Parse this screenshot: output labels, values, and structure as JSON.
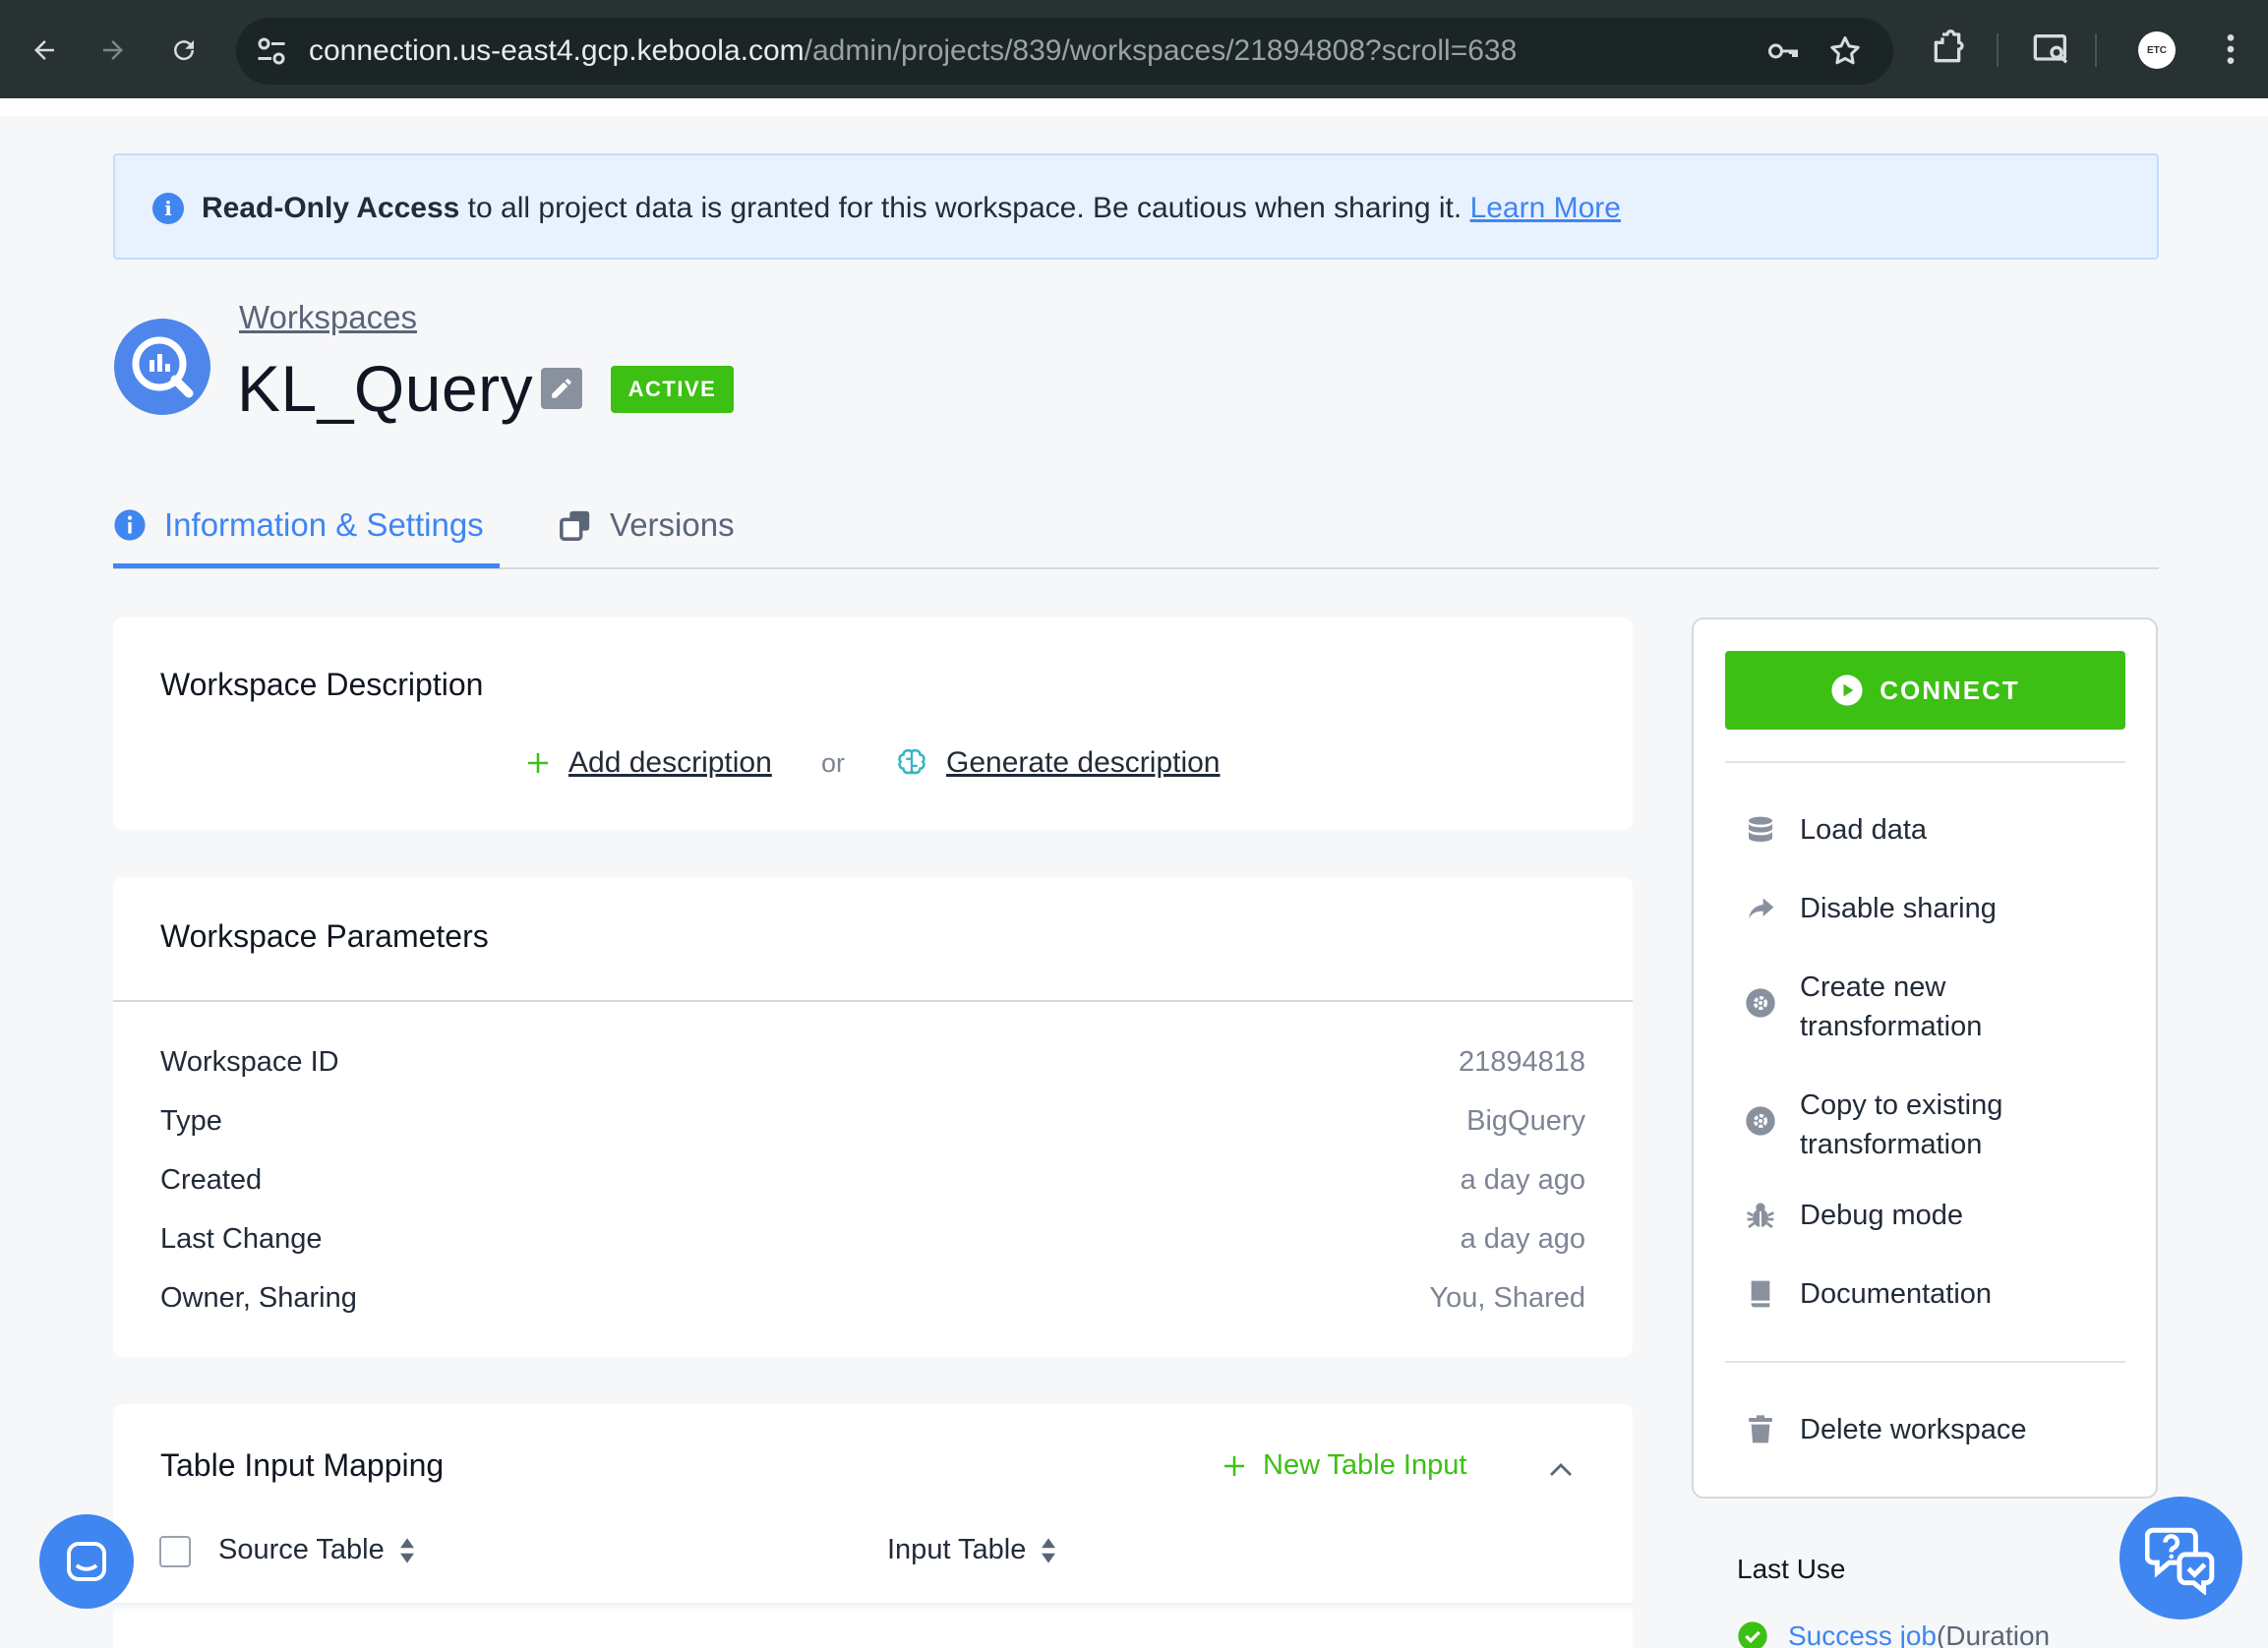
{
  "browser": {
    "url_host": "connection.us-east4.gcp.keboola.com",
    "url_path": "/admin/projects/839/workspaces/21894808?scroll=638",
    "profile_initials": "ETC"
  },
  "alert": {
    "bold": "Read-Only Access",
    "text": " to all project data is granted for this workspace. Be cautious when sharing it. ",
    "link": "Learn More"
  },
  "header": {
    "breadcrumb": "Workspaces",
    "title": "KL_Query",
    "status": "ACTIVE"
  },
  "tabs": [
    {
      "label": "Information & Settings",
      "active": true
    },
    {
      "label": "Versions",
      "active": false
    }
  ],
  "description_card": {
    "title": "Workspace Description",
    "add_label": "Add description",
    "or_label": "or",
    "generate_label": "Generate description"
  },
  "parameters_card": {
    "title": "Workspace Parameters",
    "rows": [
      {
        "key": "Workspace ID",
        "value": "21894818"
      },
      {
        "key": "Type",
        "value": "BigQuery"
      },
      {
        "key": "Created",
        "value": "a day ago"
      },
      {
        "key": "Last Change",
        "value": "a day ago"
      },
      {
        "key": "Owner, Sharing",
        "value": "You, Shared"
      }
    ]
  },
  "mapping_card": {
    "title": "Table Input Mapping",
    "new_input_label": "New Table Input",
    "columns": [
      "Source Table",
      "Input Table"
    ]
  },
  "sidebar": {
    "connect_label": "CONNECT",
    "items": [
      {
        "label": "Load data",
        "icon": "database-icon"
      },
      {
        "label": "Disable sharing",
        "icon": "share-arrow-icon"
      },
      {
        "label": "Create new transformation",
        "icon": "gear-circle-icon"
      },
      {
        "label": "Copy to existing transformation",
        "icon": "gear-circle-icon"
      },
      {
        "label": "Debug mode",
        "icon": "bug-icon"
      },
      {
        "label": "Documentation",
        "icon": "book-icon"
      }
    ],
    "delete_label": "Delete workspace",
    "last_use_title": "Last Use",
    "last_job_link": "Success job",
    "last_job_suffix": " (Duration"
  },
  "colors": {
    "accent": "#3f86f1",
    "success": "#3cc014",
    "chrome": "#283233"
  }
}
